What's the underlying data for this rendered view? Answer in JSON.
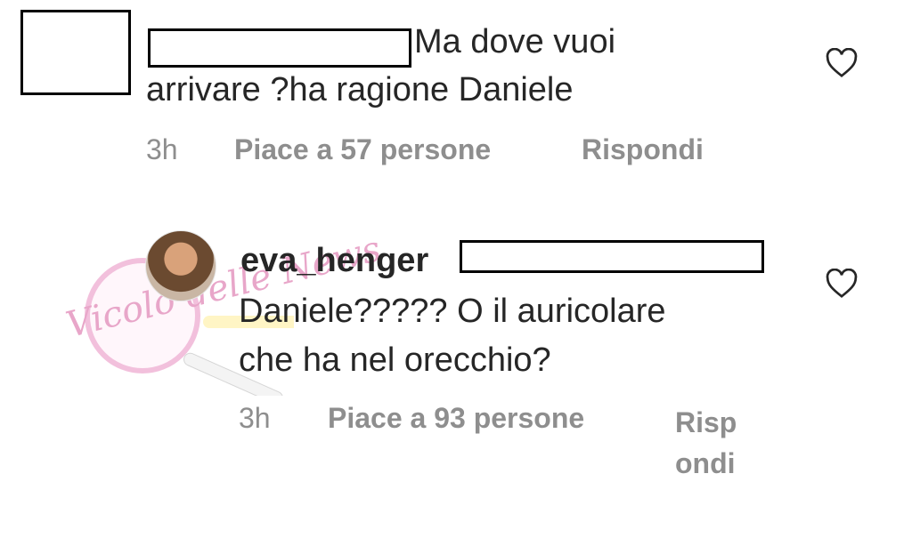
{
  "comment1": {
    "username_partial": "",
    "text_line1": "Ma dove vuoi",
    "text_line2": "arrivare ?ha ragione Daniele",
    "time": "3h",
    "likes": "Piace a 57 persone",
    "reply": "Rispondi"
  },
  "comment2": {
    "username": "eva_henger",
    "text_line1": "Daniele????? O il auricolare",
    "text_line2": "che ha nel orecchio?",
    "time": "3h",
    "likes": "Piace a 93 persone",
    "reply": "Rispondi"
  },
  "watermark": {
    "brand": "Vicolo delle News"
  },
  "icons": {
    "like": "heart-outline-icon"
  },
  "colors": {
    "text": "#262626",
    "meta": "#8e8e8e",
    "watermark": "#e8a6c9"
  }
}
